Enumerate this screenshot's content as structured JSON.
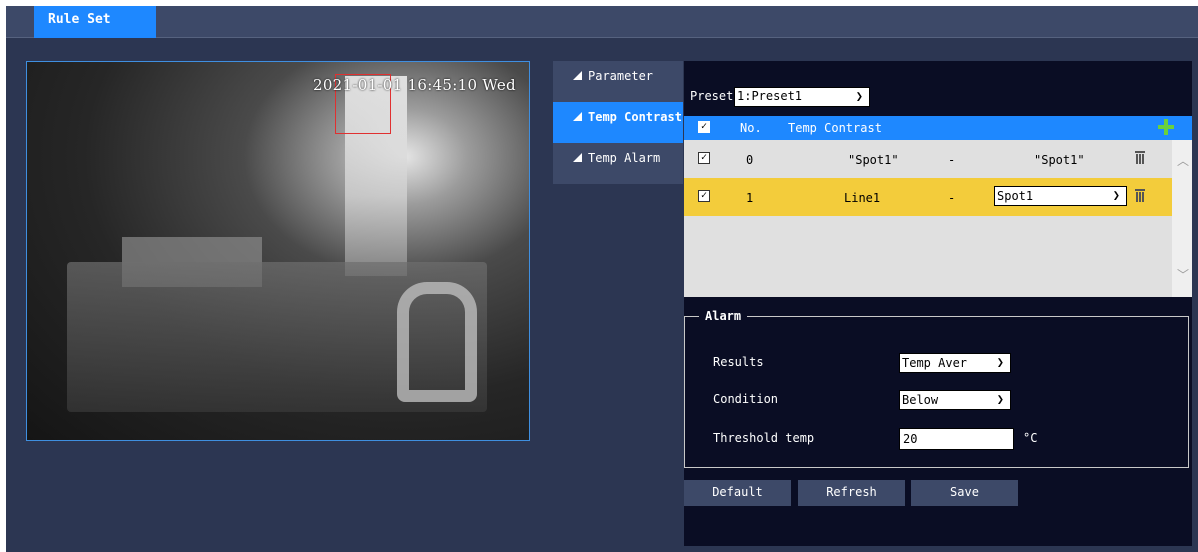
{
  "header": {
    "tab_label": "Rule Set"
  },
  "video": {
    "osd_text": "2021-01-01 16:45:10 Wed"
  },
  "menu": {
    "items": [
      {
        "label": "Parameter",
        "active": false
      },
      {
        "label": "Temp Contrast",
        "active": true
      },
      {
        "label": "Temp Alarm",
        "active": false
      }
    ]
  },
  "preset": {
    "label": "Preset",
    "value": "1:Preset1"
  },
  "table": {
    "headers": {
      "no": "No.",
      "temp_contrast": "Temp Contrast"
    },
    "rows": [
      {
        "checked": true,
        "no": "0",
        "source": "\"Spot1\"",
        "op": "-",
        "target": "\"Spot1\"",
        "highlighted": false
      },
      {
        "checked": true,
        "no": "1",
        "source": "Line1",
        "op": "-",
        "target": "Spot1",
        "highlighted": true
      }
    ]
  },
  "alarm": {
    "legend": "Alarm",
    "results_label": "Results",
    "results_value": "Temp Aver",
    "condition_label": "Condition",
    "condition_value": "Below",
    "threshold_label": "Threshold temp",
    "threshold_value": "20",
    "unit": "°C"
  },
  "buttons": {
    "default": "Default",
    "refresh": "Refresh",
    "save": "Save"
  },
  "colors": {
    "accent": "#1e88ff",
    "highlight_row": "#f3cc3b",
    "add_icon": "#6bd13b",
    "roi": "#e03030"
  }
}
